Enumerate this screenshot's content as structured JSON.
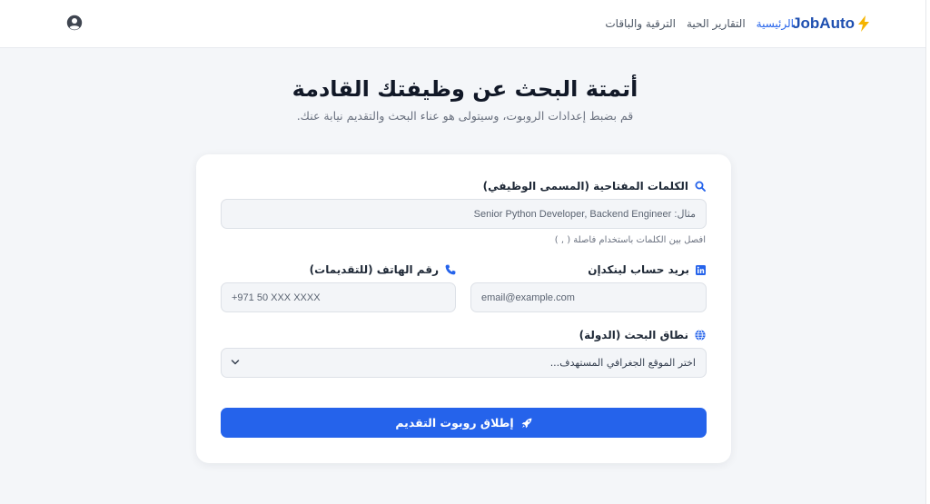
{
  "brand": {
    "name": "JobAuto",
    "icon": "lightning-bolt-icon",
    "color": "#1e4fb0",
    "bolt_color": "#f5b400"
  },
  "nav": {
    "items": [
      {
        "label": "الرئيسية",
        "active": true
      },
      {
        "label": "التقارير الحية",
        "active": false
      },
      {
        "label": "الترقية والباقات",
        "active": false
      }
    ],
    "profile_icon": "user-circle-icon"
  },
  "hero": {
    "title": "أتمتة البحث عن وظيفتك القادمة",
    "subtitle": "قم بضبط إعدادات الروبوت، وسيتولى هو عناء البحث والتقديم نيابة عنك."
  },
  "form": {
    "keywords": {
      "label": "الكلمات المفتاحية (المسمى الوظيفي)",
      "placeholder": "مثال: Senior Python Developer, Backend Engineer",
      "hint": "افصل بين الكلمات باستخدام فاصلة ( , )",
      "icon": "search-icon"
    },
    "linkedin": {
      "label": "بريد حساب لينكدإن",
      "placeholder": "email@example.com",
      "icon": "linkedin-icon"
    },
    "phone": {
      "label": "رقم الهاتف (للتقديمات)",
      "placeholder": "+971 50 XXX XXXX",
      "icon": "phone-icon"
    },
    "location": {
      "label": "نطاق البحث (الدولة)",
      "selected": "اختر الموقع الجغرافي المستهدف...",
      "icon": "globe-icon"
    },
    "submit": {
      "label": "إطلاق روبوت التقديم",
      "icon": "rocket-icon"
    }
  },
  "colors": {
    "accent": "#2563eb",
    "background": "#f4f6f9",
    "card": "#ffffff"
  }
}
